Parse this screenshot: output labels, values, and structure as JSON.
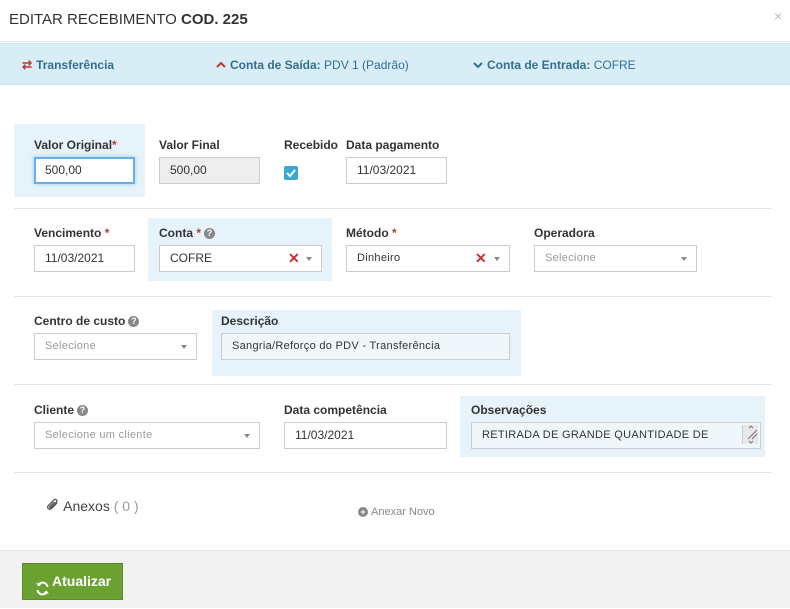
{
  "modal": {
    "title": "EDITAR RECEBIMENTO",
    "code": "COD. 225",
    "close": "×"
  },
  "info_bar": {
    "transfer": "Transferência",
    "saida_label": "Conta de Saída:",
    "saida_value": "PDV 1 (Padrão)",
    "entrada_label": "Conta de Entrada:",
    "entrada_value": "COFRE"
  },
  "form": {
    "valor_original": {
      "label": "Valor Original",
      "required": "*",
      "value": "500,00"
    },
    "valor_final": {
      "label": "Valor Final",
      "value": "500,00"
    },
    "recebido": {
      "label": "Recebido",
      "checked": true
    },
    "data_pagamento": {
      "label": "Data pagamento",
      "value": "11/03/2021"
    },
    "vencimento": {
      "label": "Vencimento",
      "required": "*",
      "value": "11/03/2021"
    },
    "conta": {
      "label": "Conta",
      "required": "*",
      "value": "COFRE"
    },
    "metodo": {
      "label": "Método",
      "required": "*",
      "value": "Dinheiro"
    },
    "operadora": {
      "label": "Operadora",
      "placeholder": "Selecione"
    },
    "centro_custo": {
      "label": "Centro de custo",
      "placeholder": "Selecione"
    },
    "descricao": {
      "label": "Descrição",
      "value": "Sangria/Reforço do PDV - Transferência"
    },
    "cliente": {
      "label": "Cliente",
      "placeholder": "Selecione um cliente"
    },
    "data_competencia": {
      "label": "Data competência",
      "value": "11/03/2021"
    },
    "observacoes": {
      "label": "Observações",
      "value": "RETIRADA DE GRANDE QUANTIDADE DE"
    }
  },
  "anexos": {
    "label": "Anexos",
    "count": "( 0 )",
    "add": "Anexar Novo"
  },
  "footer": {
    "update": "Atualizar"
  },
  "icons": {
    "transfer": "exchange-icon",
    "saida": "chevron-up-icon",
    "entrada": "chevron-down-icon",
    "help": "question-circle-icon",
    "clear": "times-icon",
    "paperclip": "paperclip-icon",
    "plus": "plus-circle-icon",
    "refresh": "refresh-icon"
  },
  "colors": {
    "info_bar": "#d9edf7",
    "info_text": "#31708f",
    "highlight": "#e6f3fb",
    "checkbox": "#3aa8d0",
    "update_button": "#6aa131",
    "clear_icon": "#c9302c"
  }
}
